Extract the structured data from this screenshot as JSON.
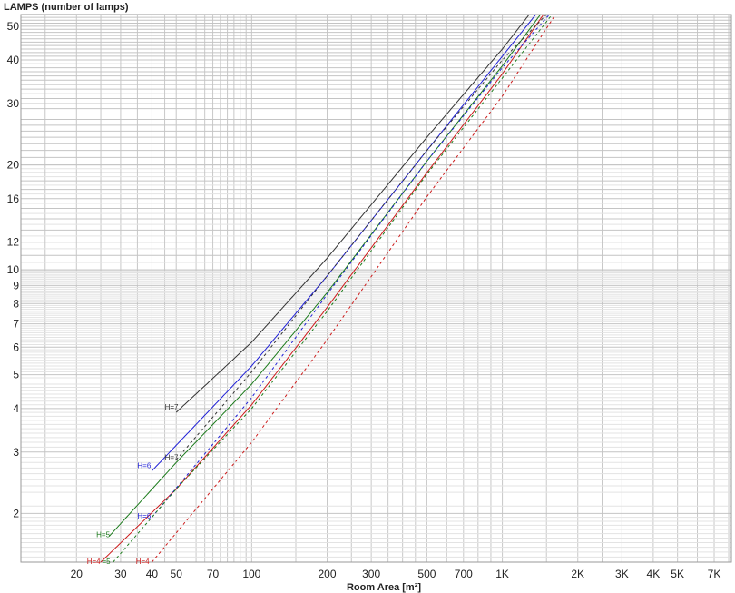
{
  "chart_data": {
    "type": "line",
    "title": "LAMPS (number of lamps)",
    "xlabel": "Room Area [m²]",
    "ylabel": "",
    "x_scale": "log",
    "y_scale": "log",
    "xlim": [
      12,
      8200
    ],
    "ylim": [
      1.45,
      54
    ],
    "grid": true,
    "x_ticks": [
      {
        "value": 20,
        "label": "20"
      },
      {
        "value": 30,
        "label": "30"
      },
      {
        "value": 40,
        "label": "40"
      },
      {
        "value": 50,
        "label": "50"
      },
      {
        "value": 70,
        "label": "70"
      },
      {
        "value": 100,
        "label": "100"
      },
      {
        "value": 200,
        "label": "200"
      },
      {
        "value": 300,
        "label": "300"
      },
      {
        "value": 500,
        "label": "500"
      },
      {
        "value": 700,
        "label": "700"
      },
      {
        "value": 1000,
        "label": "1K"
      },
      {
        "value": 2000,
        "label": "2K"
      },
      {
        "value": 3000,
        "label": "3K"
      },
      {
        "value": 4000,
        "label": "4K"
      },
      {
        "value": 5000,
        "label": "5K"
      },
      {
        "value": 7000,
        "label": "7K"
      }
    ],
    "y_ticks": [
      {
        "value": 2,
        "label": "2"
      },
      {
        "value": 3,
        "label": "3"
      },
      {
        "value": 4,
        "label": "4"
      },
      {
        "value": 5,
        "label": "5"
      },
      {
        "value": 6,
        "label": "6"
      },
      {
        "value": 7,
        "label": "7"
      },
      {
        "value": 8,
        "label": "8"
      },
      {
        "value": 9,
        "label": "9"
      },
      {
        "value": 10,
        "label": "10"
      },
      {
        "value": 12,
        "label": "12"
      },
      {
        "value": 16,
        "label": "16"
      },
      {
        "value": 20,
        "label": "20"
      },
      {
        "value": 30,
        "label": "30"
      },
      {
        "value": 40,
        "label": "40"
      },
      {
        "value": 50,
        "label": "50"
      }
    ],
    "series": [
      {
        "label": "H=7",
        "color": "#333333",
        "style": "solid",
        "x": [
          50,
          100,
          200,
          500,
          1000,
          1280
        ],
        "y": [
          3.9,
          6.2,
          10.8,
          24,
          43,
          54
        ]
      },
      {
        "label": "H=6",
        "color": "#1f1fd6",
        "style": "solid",
        "x": [
          40,
          100,
          200,
          500,
          1000,
          1360
        ],
        "y": [
          2.65,
          5.3,
          9.6,
          22,
          41,
          54
        ]
      },
      {
        "label": "H=5",
        "color": "#1a7a1a",
        "style": "solid",
        "x": [
          27,
          50,
          100,
          200,
          500,
          1000,
          1420
        ],
        "y": [
          1.72,
          2.8,
          4.7,
          8.6,
          20.5,
          38.5,
          54
        ]
      },
      {
        "label": "H=4",
        "color": "#cc1a1a",
        "style": "solid",
        "x": [
          25,
          50,
          100,
          200,
          500,
          1000,
          1460
        ],
        "y": [
          1.45,
          2.35,
          4.1,
          7.8,
          19,
          36.5,
          54
        ]
      },
      {
        "label": "H=7",
        "color": "#333333",
        "style": "dashed",
        "x": [
          50,
          100,
          200,
          500,
          1000,
          1500
        ],
        "y": [
          2.85,
          5.1,
          9.6,
          22,
          40,
          54
        ]
      },
      {
        "label": "H=6",
        "color": "#1f1fd6",
        "style": "dashed",
        "x": [
          40,
          100,
          200,
          500,
          1000,
          1540
        ],
        "y": [
          1.95,
          4.3,
          8.5,
          20.5,
          38,
          54
        ]
      },
      {
        "label": "H=5",
        "color": "#1a7a1a",
        "style": "dashed",
        "x": [
          28,
          50,
          100,
          200,
          500,
          1000,
          1580
        ],
        "y": [
          1.45,
          2.35,
          4.0,
          7.6,
          18.8,
          35.5,
          54
        ]
      },
      {
        "label": "H=4",
        "color": "#cc1a1a",
        "style": "dashed",
        "x": [
          40,
          100,
          200,
          500,
          1000,
          1630
        ],
        "y": [
          1.45,
          3.2,
          6.3,
          16.2,
          31.5,
          54
        ]
      }
    ],
    "curve_labels": [
      {
        "text": "H=7",
        "color": "#333333",
        "x": 45,
        "y": 4.05
      },
      {
        "text": "H=7",
        "color": "#333333",
        "x": 45,
        "y": 2.9
      },
      {
        "text": "H=6",
        "color": "#1f1fd6",
        "x": 35,
        "y": 2.75
      },
      {
        "text": "H=6",
        "color": "#1f1fd6",
        "x": 35,
        "y": 1.97
      },
      {
        "text": "H=5",
        "color": "#1a7a1a",
        "x": 24,
        "y": 1.74
      },
      {
        "text": "H=4",
        "color": "#cc1a1a",
        "x": 34.5,
        "y": 1.46
      },
      {
        "text": "H=4",
        "color": "#cc1a1a",
        "x": 22,
        "y": 1.46
      },
      {
        "text": "=5",
        "color": "#1a7a1a",
        "x": 25.3,
        "y": 1.46
      }
    ]
  }
}
